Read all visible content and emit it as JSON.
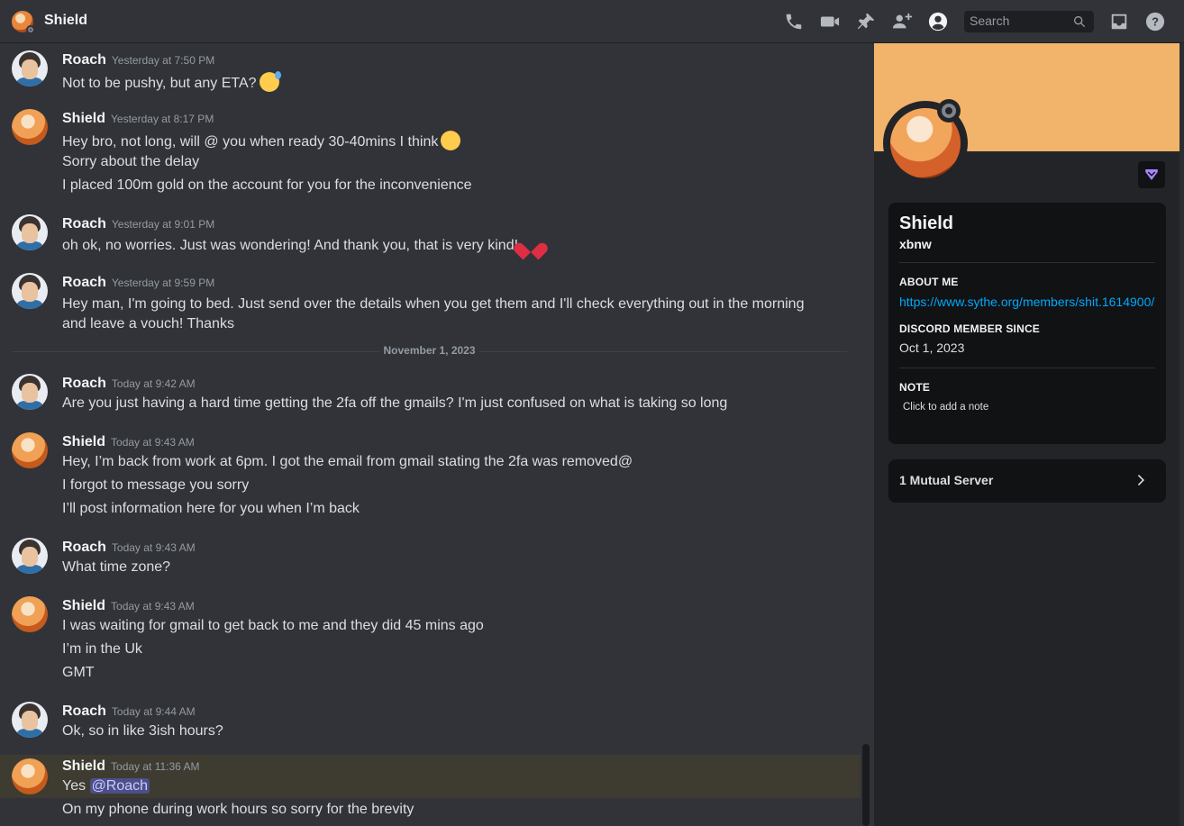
{
  "header": {
    "title": "Shield",
    "search_placeholder": "Search",
    "icons": [
      "phone-call-icon",
      "video-icon",
      "pin-icon",
      "add-friend-icon",
      "user-profile-icon",
      "inbox-icon",
      "help-icon"
    ]
  },
  "messages": [
    {
      "author": "Roach",
      "timestamp": "Yesterday at 7:50 PM",
      "lines": [
        "Not to be pushy, but any ETA?"
      ]
    },
    {
      "author": "Shield",
      "timestamp": "Yesterday at 8:17 PM",
      "lines": [
        "Hey bro, not long, will @ you when ready 30-40mins I think",
        "Sorry about the delay",
        "I placed 100m gold on the account for you for the inconvenience"
      ]
    },
    {
      "author": "Roach",
      "timestamp": "Yesterday at 9:01 PM",
      "lines": [
        "oh ok, no worries. Just was wondering! And thank you, that is very kind!"
      ]
    },
    {
      "author": "Roach",
      "timestamp": "Yesterday at 9:59 PM",
      "lines": [
        "Hey man, I'm going to bed. Just send over the details when you get them and I'll check everything out in the morning and leave a vouch! Thanks"
      ]
    },
    {
      "author": "Roach",
      "timestamp": "Today at 9:42 AM",
      "lines": [
        "Are you just having a hard time getting the 2fa off the gmails? I'm just confused on what is taking so long"
      ]
    },
    {
      "author": "Shield",
      "timestamp": "Today at 9:43 AM",
      "lines": [
        "Hey, I’m back from work at 6pm. I got the email from gmail stating the 2fa was removed@",
        "I forgot to message you sorry",
        "I’ll post information here for you when I’m back"
      ]
    },
    {
      "author": "Roach",
      "timestamp": "Today at 9:43 AM",
      "lines": [
        "What time zone?"
      ]
    },
    {
      "author": "Shield",
      "timestamp": "Today at 9:43 AM",
      "lines": [
        "I was waiting for gmail to get back to me and they did 45 mins ago",
        "I’m in the Uk",
        "GMT"
      ]
    },
    {
      "author": "Roach",
      "timestamp": "Today at 9:44 AM",
      "lines": [
        "Ok, so in like 3ish hours?"
      ]
    },
    {
      "author": "Shield",
      "timestamp": "Today at 11:36 AM",
      "lines": [
        "Yes",
        "On my phone during work hours so sorry for the brevity"
      ],
      "mention": "@Roach"
    }
  ],
  "date_divider": "November 1, 2023",
  "profile": {
    "display_name": "Shield",
    "username": "xbnw",
    "about_label": "ABOUT ME",
    "about_link": "https://www.sythe.org/members/shit.1614900/",
    "since_label": "DISCORD MEMBER SINCE",
    "since_value": "Oct 1, 2023",
    "note_label": "NOTE",
    "note_placeholder": "Click to add a note",
    "mutual_servers": "1 Mutual Server",
    "banner_color": "#f2b46a"
  },
  "colors": {
    "accent_link": "#00a8fc",
    "mention_bg": "#4b4f8a",
    "highlight_bg": "#3e3b31"
  }
}
